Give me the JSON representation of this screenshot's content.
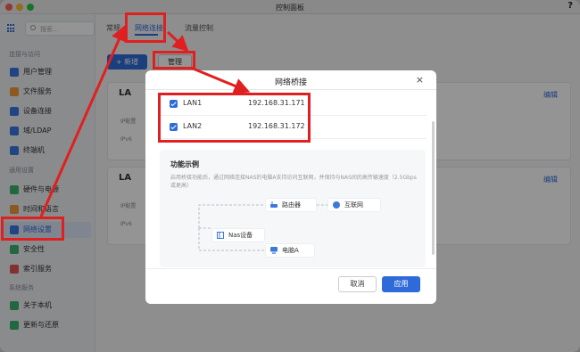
{
  "window": {
    "title": "控制面板",
    "help": "?"
  },
  "sidebar": {
    "search_placeholder": "搜索…",
    "section1": "连接与访问",
    "items1": [
      {
        "label": "用户管理",
        "color": "#3a78e0"
      },
      {
        "label": "文件服务",
        "color": "#f29a38"
      },
      {
        "label": "设备连接",
        "color": "#3a78e0"
      },
      {
        "label": "域/LDAP",
        "color": "#3a78e0"
      },
      {
        "label": "终端机",
        "color": "#3a78e0"
      }
    ],
    "section2": "通用设置",
    "items2": [
      {
        "label": "硬件与电源",
        "color": "#3ab36f"
      },
      {
        "label": "时间和语言",
        "color": "#f29a38"
      },
      {
        "label": "网络设置",
        "color": "#3a78e0",
        "active": true
      },
      {
        "label": "安全性",
        "color": "#3ab36f"
      },
      {
        "label": "索引服务",
        "color": "#e05555"
      }
    ],
    "section3": "系统服务",
    "items3": [
      {
        "label": "关于本机",
        "color": "#3ab36f"
      },
      {
        "label": "更新与还原",
        "color": "#3ab36f"
      }
    ]
  },
  "tabs": [
    "常规",
    "网络连接",
    "流量控制"
  ],
  "active_tab": "网络连接",
  "toolbar": {
    "add_label": "+ 新增",
    "manage_label": "管理"
  },
  "cards": [
    {
      "title": "LA",
      "edit": "编辑",
      "labels": [
        "IP配置",
        "IPv6"
      ]
    },
    {
      "title": "LA",
      "edit": "编辑",
      "labels": [
        "IP配置",
        "IPv6"
      ]
    }
  ],
  "modal": {
    "title": "网络桥接",
    "close": "×",
    "lans": [
      {
        "name": "LAN1",
        "ip": "192.168.31.171",
        "checked": true
      },
      {
        "name": "LAN2",
        "ip": "192.168.31.172",
        "checked": true
      }
    ],
    "demo_title": "功能示例",
    "demo_desc": "启用桥接功能后，通过网络连接NAS的电脑A支持访问互联网，并保持与NAS间的高传输速度（2.5Gbps或更高）",
    "nodes": {
      "nas": "Nas设备",
      "router": "路由器",
      "internet": "互联网",
      "pc": "电脑A"
    },
    "cancel": "取消",
    "apply": "应用"
  },
  "colors": {
    "accent": "#2f6bd8",
    "highlight": "#e02020"
  }
}
